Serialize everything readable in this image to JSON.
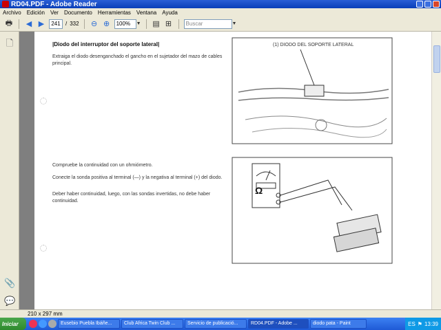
{
  "window": {
    "title": "RD04.PDF - Adobe Reader"
  },
  "menu": [
    "Archivo",
    "Edición",
    "Ver",
    "Documento",
    "Herramientas",
    "Ventana",
    "Ayuda"
  ],
  "toolbar": {
    "page_current": "241",
    "page_total": "332",
    "zoom": "100%",
    "search_placeholder": "Buscar"
  },
  "document": {
    "heading": "Diodo del interruptor del soporte lateral",
    "para1": "Extraiga el diodo desenganchado el gancho en el sujetador del mazo de cables principal.",
    "para2": "Compruebe la continuidad con un ohmiómetro.",
    "para3": "Conecte la sonda positiva al terminal (—) y la negativa al terminal (+) del diodo.",
    "para4": "Deber haber continuidad, luego, con las sondas invertidas, no debe haber continuidad.",
    "figure1_label": "(1) DIODO DEL SOPORTE LATERAL",
    "ohm_symbol": "Ω"
  },
  "status": {
    "page_size": "210 x 297 mm"
  },
  "taskbar": {
    "start": "Iniciar",
    "items": [
      "Eusebio Puebla Ibáñe...",
      "Club Africa Twin Club ...",
      "Servicio de publicació...",
      "RD04.PDF - Adobe ...",
      "diodo pata - Paint"
    ],
    "lang": "ES",
    "time": "13:39"
  }
}
